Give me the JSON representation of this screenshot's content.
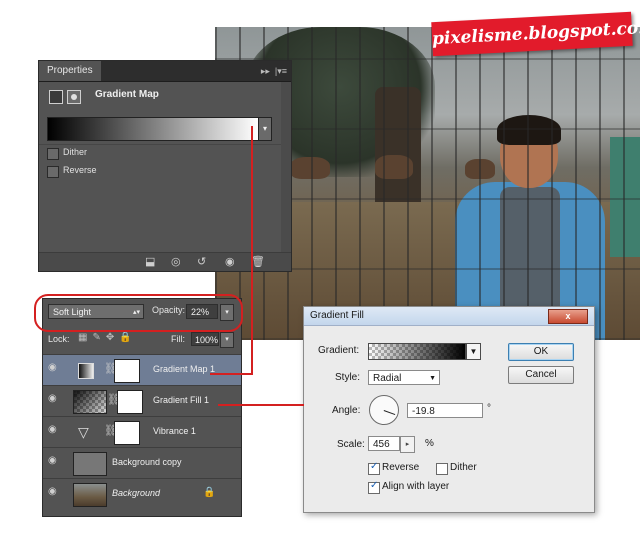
{
  "watermark": "pixelisme.blogspot.co.id",
  "properties_panel": {
    "tab": "Properties",
    "title": "Gradient Map",
    "dither_label": "Dither",
    "reverse_label": "Reverse"
  },
  "layers_panel": {
    "blend_mode": "Soft Light",
    "opacity_label": "Opacity:",
    "opacity_value": "22%",
    "lock_label": "Lock:",
    "fill_label": "Fill:",
    "fill_value": "100%",
    "layers": [
      {
        "name": "Gradient Map 1"
      },
      {
        "name": "Gradient Fill 1"
      },
      {
        "name": "Vibrance 1"
      },
      {
        "name": "Background copy"
      },
      {
        "name": "Background"
      }
    ]
  },
  "gradient_fill_dialog": {
    "title": "Gradient Fill",
    "gradient_label": "Gradient:",
    "style_label": "Style:",
    "style_value": "Radial",
    "angle_label": "Angle:",
    "angle_value": "-19.8",
    "angle_unit": "°",
    "scale_label": "Scale:",
    "scale_value": "456",
    "scale_unit": "%",
    "reverse_label": "Reverse",
    "reverse_checked": true,
    "dither_label": "Dither",
    "dither_checked": false,
    "align_label": "Align with layer",
    "align_checked": true,
    "ok_label": "OK",
    "cancel_label": "Cancel",
    "close_glyph": "x"
  },
  "colors": {
    "accent_red": "#d42020",
    "banner_red": "#e21b2b",
    "panel_bg": "#535353",
    "selected_layer": "#6f7d95"
  }
}
